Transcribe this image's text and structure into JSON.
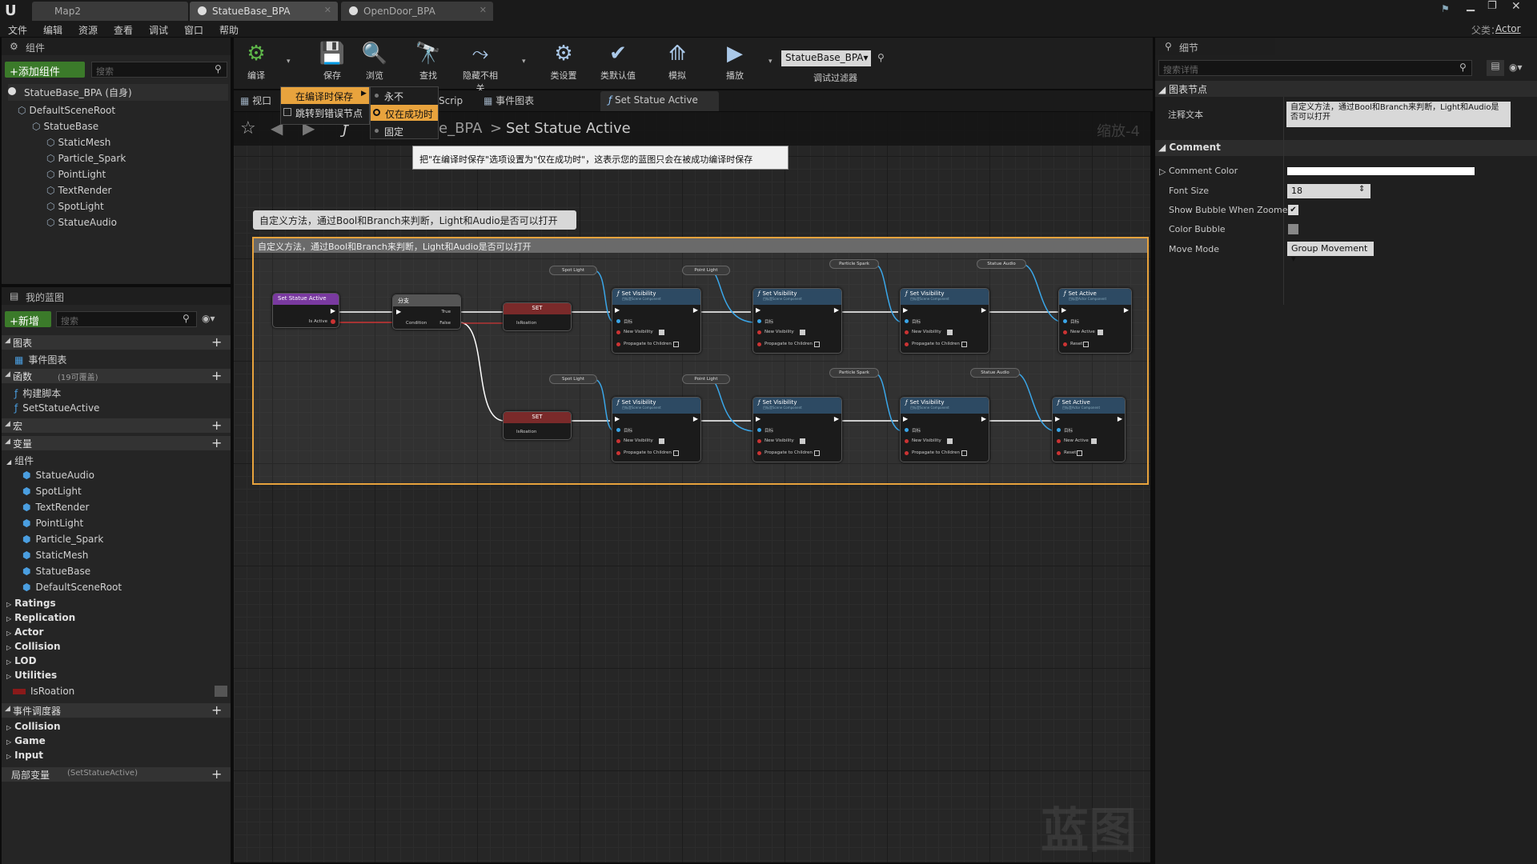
{
  "app": {
    "logo": "U"
  },
  "tabs": [
    {
      "label": "Map2"
    },
    {
      "label": "StatueBase_BPA"
    },
    {
      "label": "OpenDoor_BPA"
    }
  ],
  "parent": {
    "label": "父类：",
    "value": "Actor"
  },
  "menu": [
    "文件",
    "编辑",
    "资源",
    "查看",
    "调试",
    "窗口",
    "帮助"
  ],
  "components": {
    "title": "组件",
    "add_button": "+添加组件",
    "search_placeholder": "搜索",
    "root_item": "StatueBase_BPA (自身)",
    "tree": [
      {
        "label": "DefaultSceneRoot",
        "level": 0
      },
      {
        "label": "StatueBase",
        "level": 1
      },
      {
        "label": "StaticMesh",
        "level": 2
      },
      {
        "label": "Particle_Spark",
        "level": 2
      },
      {
        "label": "PointLight",
        "level": 2
      },
      {
        "label": "TextRender",
        "level": 2
      },
      {
        "label": "SpotLight",
        "level": 2
      },
      {
        "label": "StatueAudio",
        "level": 2
      }
    ]
  },
  "my_blueprint": {
    "title": "我的蓝图",
    "new_button": "+新增",
    "search_placeholder": "搜索",
    "sections": {
      "graphs": "图表",
      "event_graph": "事件图表",
      "functions": "函数",
      "functions_count": "(19可覆盖)",
      "construct": "构建脚本",
      "set_statue": "SetStatueActive",
      "macros": "宏",
      "variables": "变量",
      "components": "组件",
      "dispatchers": "事件调度器",
      "local_vars": "局部变量",
      "local_vars_scope": "(SetStatueActive)"
    },
    "var_components": [
      "StatueAudio",
      "SpotLight",
      "TextRender",
      "PointLight",
      "Particle_Spark",
      "StaticMesh",
      "StatueBase",
      "DefaultSceneRoot"
    ],
    "var_categories": [
      "Ratings",
      "Replication",
      "Actor",
      "Collision",
      "LOD",
      "Utilities"
    ],
    "var_isroation": "IsRoation",
    "dispatcher_categories": [
      "Collision",
      "Game",
      "Input"
    ]
  },
  "toolbar": [
    {
      "label": "编译"
    },
    {
      "label": "保存"
    },
    {
      "label": "浏览"
    },
    {
      "label": "查找"
    },
    {
      "label": "隐藏不相关"
    },
    {
      "label": "类设置"
    },
    {
      "label": "类默认值"
    },
    {
      "label": "模拟"
    },
    {
      "label": "播放"
    }
  ],
  "debug": {
    "selector": "StatueBase_BPA▾",
    "label": "调试过滤器"
  },
  "editor_tabs": {
    "viewport": "视口",
    "construct": "Scrip",
    "event_graph": "事件图表",
    "function": "Set Statue Active"
  },
  "dropdown": {
    "save_on_compile": "在编译时保存",
    "jump_to_error": "跳转到错误节点",
    "options": [
      "永不",
      "仅在成功时",
      "固定"
    ],
    "selected": 1
  },
  "tooltip": "把\"在编译时保存\"选项设置为\"仅在成功时\"，这表示您的蓝图只会在被成功编译时保存",
  "breadcrumb": {
    "parent": "e_BPA",
    "sep": ">",
    "current": "Set Statue Active",
    "zoom": "缩放-4"
  },
  "graph": {
    "bubble": "自定义方法，通过Bool和Branch来判断，Light和Audio是否可以打开",
    "comment_title": "自定义方法，通过Bool和Branch来判断，Light和Audio是否可以打开",
    "watermark": "蓝图",
    "entry": {
      "title": "Set Statue Active",
      "pin": "Is Active"
    },
    "branch": {
      "title": "分支",
      "condition": "Condition",
      "true": "True",
      "false": "False"
    },
    "set": {
      "title": "SET",
      "pin": "IsRoation"
    },
    "vis_nodes": {
      "title": "Set Visibility",
      "sub": "目标是Scene Component",
      "target": "目标",
      "new_vis": "New Visibility",
      "propagate": "Propagate to Children"
    },
    "active_nodes": {
      "title": "Set Active",
      "sub": "目标是Actor Component",
      "target": "目标",
      "new_active": "New Active",
      "reset": "Reset"
    },
    "getters": [
      "Spot Light",
      "Point Light",
      "Particle Spark",
      "Statue Audio"
    ]
  },
  "details": {
    "title": "细节",
    "search_placeholder": "搜索详情",
    "section_node": "图表节点",
    "comment_text_label": "注释文本",
    "comment_text_value": "自定义方法，通过Bool和Branch来判断，Light和Audio是否可以打开",
    "section_comment": "Comment",
    "comment_color": "Comment Color",
    "font_size_label": "Font Size",
    "font_size_value": "18",
    "bubble_zoomed": "Show Bubble When Zoomed",
    "color_bubble": "Color Bubble",
    "move_mode_label": "Move Mode",
    "move_mode_value": "Group Movement"
  },
  "colors": {
    "accent": "#e8a33d",
    "green": "#3b7a2a",
    "exec": "#ffffff",
    "func_head": "#2d4a63",
    "entry_head": "#7a3aa0",
    "set_head": "#7a2a2a"
  }
}
